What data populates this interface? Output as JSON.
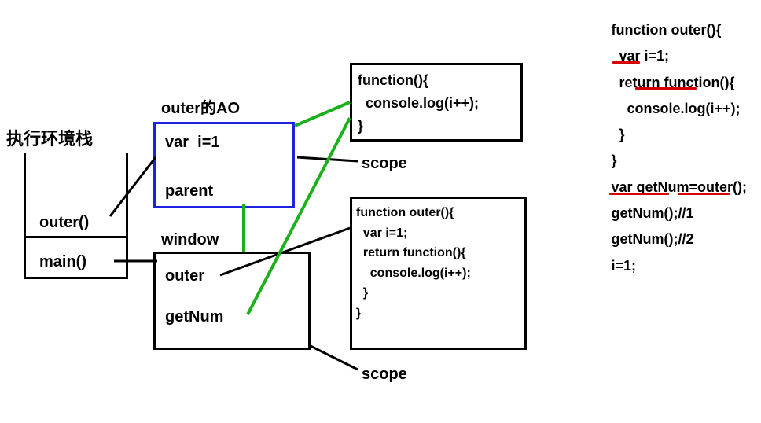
{
  "stack": {
    "title": "执行环境栈",
    "items": [
      "outer()",
      "main()"
    ]
  },
  "ao": {
    "title": "outer的AO",
    "lines": [
      "var  i=1",
      "parent"
    ]
  },
  "windowBox": {
    "title": "window",
    "lines": [
      "outer",
      "getNum"
    ]
  },
  "anonFunc": {
    "lines": "function(){\n  console.log(i++);\n}",
    "scopeLabel": "scope"
  },
  "outerFunc": {
    "lines": "function outer(){\n  var i=1;\n  return function(){\n    console.log(i++);\n  }\n}",
    "scopeLabel": "scope"
  },
  "sourceCode": {
    "lines": "function outer(){\n  var i=1;\n  return function(){\n    console.log(i++);\n  }\n}\nvar getNum=outer();\ngetNum();//1\ngetNum();//2\ni=1;"
  }
}
